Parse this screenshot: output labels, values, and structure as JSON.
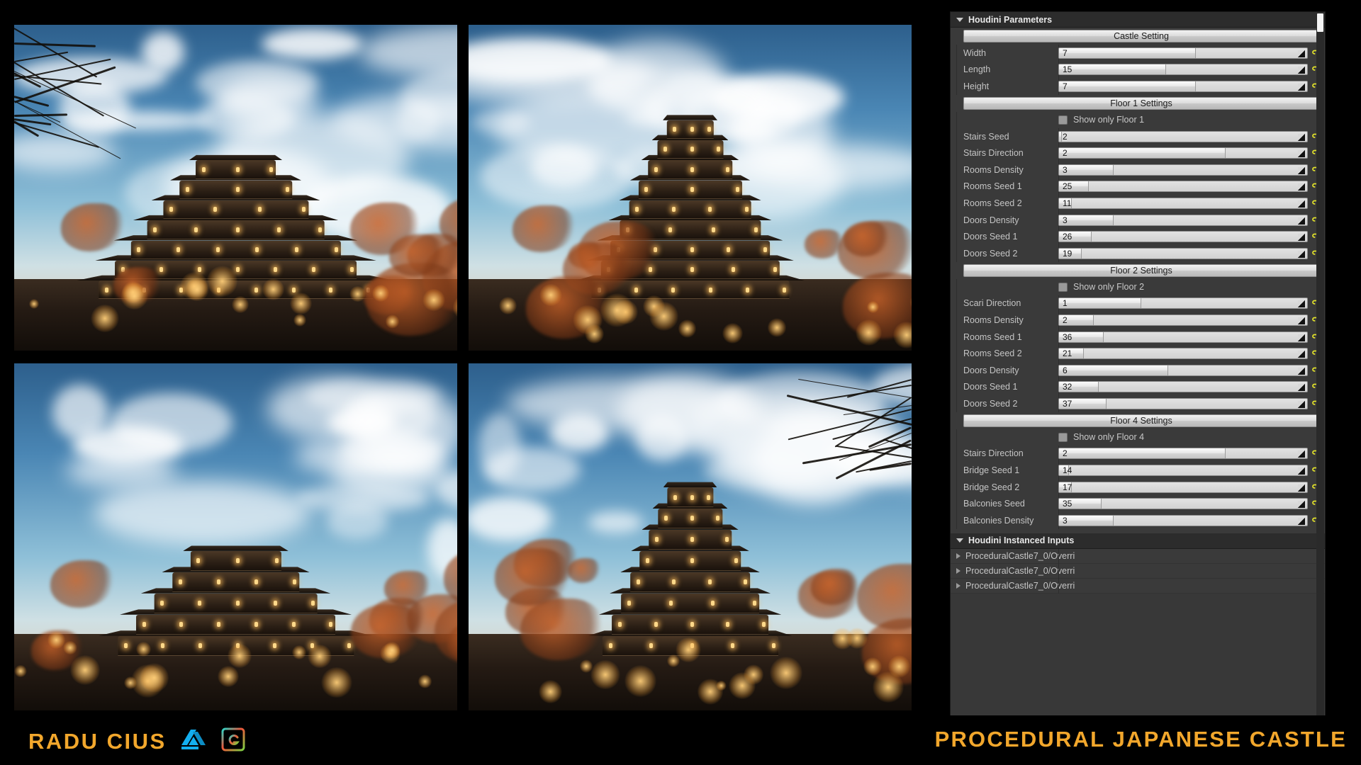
{
  "footer": {
    "credit_name": "RADU CIUS",
    "project_title": "PROCEDURAL JAPANESE CASTLE",
    "logos": [
      {
        "name": "artstation-logo",
        "label": "ARTSTATION"
      },
      {
        "name": "gumroad-logo",
        "label": ""
      }
    ],
    "accent_color": "#f2a72c"
  },
  "shots": [
    {
      "name": "render-view-front-left",
      "caption": ""
    },
    {
      "name": "render-view-front",
      "caption": ""
    },
    {
      "name": "render-view-low-angle",
      "caption": ""
    },
    {
      "name": "render-view-side",
      "caption": ""
    }
  ],
  "panel": {
    "title": "Houdini Parameters",
    "instanced_title": "Houdini Instanced Inputs",
    "castle_button": "Castle Setting",
    "castle_params": [
      {
        "label": "Width",
        "value": "7",
        "fill": 55
      },
      {
        "label": "Length",
        "value": "15",
        "fill": 43
      },
      {
        "label": "Height",
        "value": "7",
        "fill": 55
      }
    ],
    "floors": [
      {
        "button": "Floor 1 Settings",
        "checkbox": "Show only Floor 1",
        "checked": false,
        "params": [
          {
            "label": "Stairs Seed",
            "value": "2",
            "fill": 1
          },
          {
            "label": "Stairs Direction",
            "value": "2",
            "fill": 67
          },
          {
            "label": "Rooms Density",
            "value": "3",
            "fill": 22
          },
          {
            "label": "Rooms Seed 1",
            "value": "25",
            "fill": 12
          },
          {
            "label": "Rooms Seed 2",
            "value": "11",
            "fill": 5
          },
          {
            "label": "Doors Density",
            "value": "3",
            "fill": 22
          },
          {
            "label": "Doors Seed 1",
            "value": "26",
            "fill": 13
          },
          {
            "label": "Doors Seed 2",
            "value": "19",
            "fill": 9
          }
        ]
      },
      {
        "button": "Floor 2 Settings",
        "checkbox": "Show only Floor 2",
        "checked": false,
        "params": [
          {
            "label": "Scari Direction",
            "value": "1",
            "fill": 33
          },
          {
            "label": "Rooms Density",
            "value": "2",
            "fill": 14
          },
          {
            "label": "Rooms Seed 1",
            "value": "36",
            "fill": 18
          },
          {
            "label": "Rooms Seed 2",
            "value": "21",
            "fill": 10
          },
          {
            "label": "Doors Density",
            "value": "6",
            "fill": 44
          },
          {
            "label": "Doors Seed 1",
            "value": "32",
            "fill": 16
          },
          {
            "label": "Doors Seed 2",
            "value": "37",
            "fill": 19
          }
        ]
      },
      {
        "button": "Floor 4 Settings",
        "checkbox": "Show only Floor 4",
        "checked": false,
        "params": [
          {
            "label": "Stairs Direction",
            "value": "2",
            "fill": 67
          },
          {
            "label": "Bridge Seed 1",
            "value": "14",
            "fill": 4
          },
          {
            "label": "Bridge Seed 2",
            "value": "17",
            "fill": 5
          },
          {
            "label": "Balconies Seed",
            "value": "35",
            "fill": 17
          },
          {
            "label": "Balconies Density",
            "value": "3",
            "fill": 22
          }
        ]
      }
    ],
    "instanced_inputs": [
      {
        "label": "ProceduralCastle7_0/Overri"
      },
      {
        "label": "ProceduralCastle7_0/Overri"
      },
      {
        "label": "ProceduralCastle7_0/Overri"
      }
    ]
  }
}
